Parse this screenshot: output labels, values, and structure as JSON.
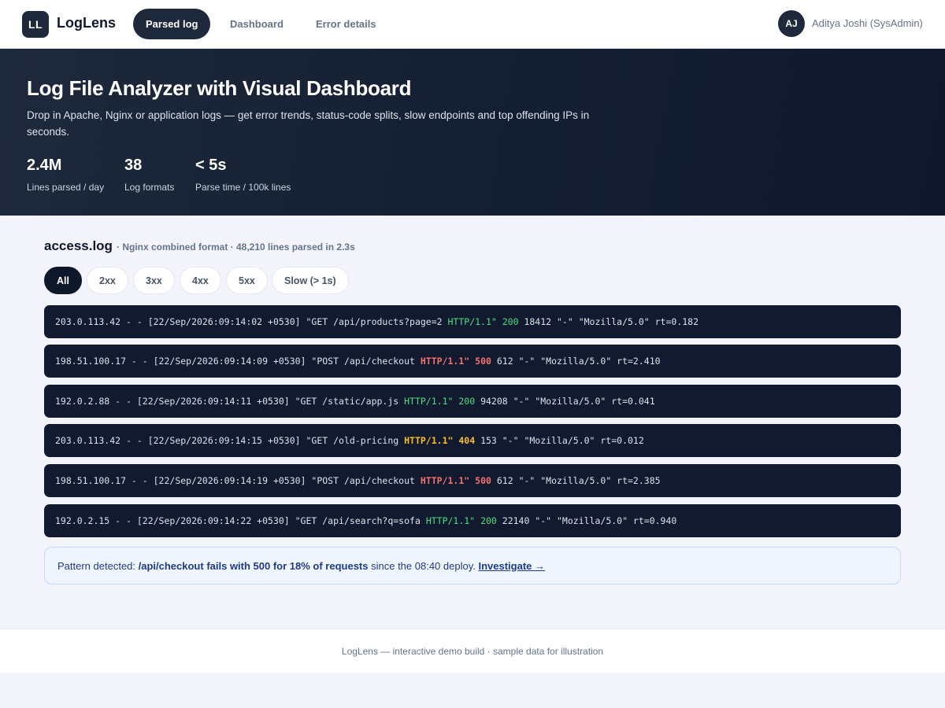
{
  "nav": {
    "logo_mark": "LL",
    "logo_text": "LogLens",
    "tabs": [
      {
        "label": "Parsed log",
        "active": true
      },
      {
        "label": "Dashboard",
        "active": false
      },
      {
        "label": "Error details",
        "active": false
      }
    ],
    "user": {
      "initials": "AJ",
      "name": "Aditya Joshi (SysAdmin)"
    }
  },
  "hero": {
    "title": "Log File Analyzer with Visual Dashboard",
    "subtitle": "Drop in Apache, Nginx or application logs — get error trends, status-code splits, slow endpoints and top offending IPs in seconds.",
    "stats": [
      {
        "value": "2.4M",
        "label": "Lines parsed / day"
      },
      {
        "value": "38",
        "label": "Log formats"
      },
      {
        "value": "< 5s",
        "label": "Parse time / 100k lines"
      }
    ]
  },
  "file": {
    "name": "access.log",
    "meta": "· Nginx combined format · 48,210 lines parsed in 2.3s"
  },
  "filters": [
    {
      "label": "All",
      "active": true
    },
    {
      "label": "2xx",
      "active": false
    },
    {
      "label": "3xx",
      "active": false
    },
    {
      "label": "4xx",
      "active": false
    },
    {
      "label": "5xx",
      "active": false
    },
    {
      "label": "Slow (> 1s)",
      "active": false
    }
  ],
  "logs": [
    {
      "prefix": "203.0.113.42 - - [22/Sep/2026:09:14:02 +0530] \"GET /api/products?page=2 ",
      "proto": "HTTP/1.1\"",
      "status": "200",
      "suffix": " 18412 \"-\" \"Mozilla/5.0\" rt=0.182",
      "level": "ok"
    },
    {
      "prefix": "198.51.100.17 - - [22/Sep/2026:09:14:09 +0530] \"POST /api/checkout ",
      "proto": "HTTP/1.1\"",
      "status": "500",
      "suffix": " 612 \"-\" \"Mozilla/5.0\" rt=2.410",
      "level": "err"
    },
    {
      "prefix": "192.0.2.88 - - [22/Sep/2026:09:14:11 +0530] \"GET /static/app.js ",
      "proto": "HTTP/1.1\"",
      "status": "200",
      "suffix": " 94208 \"-\" \"Mozilla/5.0\" rt=0.041",
      "level": "ok"
    },
    {
      "prefix": "203.0.113.42 - - [22/Sep/2026:09:14:15 +0530] \"GET /old-pricing ",
      "proto": "HTTP/1.1\"",
      "status": "404",
      "suffix": " 153 \"-\" \"Mozilla/5.0\" rt=0.012",
      "level": "warn"
    },
    {
      "prefix": "198.51.100.17 - - [22/Sep/2026:09:14:19 +0530] \"POST /api/checkout ",
      "proto": "HTTP/1.1\"",
      "status": "500",
      "suffix": " 612 \"-\" \"Mozilla/5.0\" rt=2.385",
      "level": "err"
    },
    {
      "prefix": "192.0.2.15 - - [22/Sep/2026:09:14:22 +0530] \"GET /api/search?q=sofa ",
      "proto": "HTTP/1.1\"",
      "status": "200",
      "suffix": " 22140 \"-\" \"Mozilla/5.0\" rt=0.940",
      "level": "ok"
    }
  ],
  "alert": {
    "lead": "Pattern detected: ",
    "emphasis": "/api/checkout fails with 500 for 18% of requests",
    "tail": " since the 08:40 deploy. ",
    "link": "Investigate →"
  },
  "footer": {
    "text": "LogLens — interactive demo build · sample data for illustration"
  },
  "colors": {
    "nav_active": "#1e293b",
    "hero_bg": "#0f172a",
    "status_ok": "#4ade80",
    "status_error": "#f87171",
    "status_warn": "#fbbf24",
    "alert_bg": "#eff6ff",
    "alert_text": "#1e3a8a"
  }
}
